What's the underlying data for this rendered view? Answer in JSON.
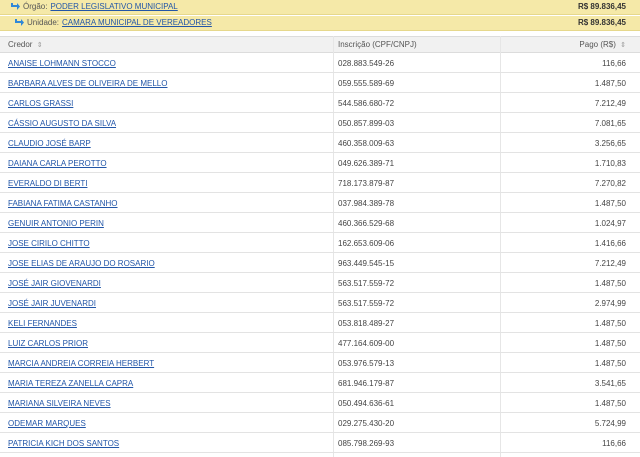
{
  "group": {
    "orgao": {
      "label": "Órgão:",
      "link": "PODER LEGISLATIVO MUNICIPAL",
      "value": "R$ 89.836,45"
    },
    "unidade": {
      "label": "Unidade:",
      "link": "CAMARA MUNICIPAL DE VEREADORES",
      "value": "R$ 89.836,45"
    }
  },
  "table": {
    "headers": {
      "credor": "Credor",
      "inscricao": "Inscrição (CPF/CNPJ)",
      "pago": "Pago (R$)",
      "sort_icon": "⇕"
    },
    "rows": [
      {
        "credor": "ANAISE LOHMANN STOCCO",
        "inscricao": "028.883.549-26",
        "pago": "116,66"
      },
      {
        "credor": "BARBARA ALVES DE OLIVEIRA DE MELLO",
        "inscricao": "059.555.589-69",
        "pago": "1.487,50"
      },
      {
        "credor": "CARLOS GRASSI",
        "inscricao": "544.586.680-72",
        "pago": "7.212,49"
      },
      {
        "credor": "CÁSSIO AUGUSTO DA SILVA",
        "inscricao": "050.857.899-03",
        "pago": "7.081,65"
      },
      {
        "credor": "CLAUDIO JOSÉ BARP",
        "inscricao": "460.358.009-63",
        "pago": "3.256,65"
      },
      {
        "credor": "DAIANA CARLA PEROTTO",
        "inscricao": "049.626.389-71",
        "pago": "1.710,83"
      },
      {
        "credor": "EVERALDO DI BERTI",
        "inscricao": "718.173.879-87",
        "pago": "7.270,82"
      },
      {
        "credor": "FABIANA FATIMA CASTANHO",
        "inscricao": "037.984.389-78",
        "pago": "1.487,50"
      },
      {
        "credor": "GENUIR ANTONIO PERIN",
        "inscricao": "460.366.529-68",
        "pago": "1.024,97"
      },
      {
        "credor": "JOSE CIRILO CHITTO",
        "inscricao": "162.653.609-06",
        "pago": "1.416,66"
      },
      {
        "credor": "JOSE ELIAS DE ARAUJO DO ROSARIO",
        "inscricao": "963.449.545-15",
        "pago": "7.212,49"
      },
      {
        "credor": "JOSÉ JAIR GIOVENARDI",
        "inscricao": "563.517.559-72",
        "pago": "1.487,50"
      },
      {
        "credor": "JOSÉ JAIR JUVENARDI",
        "inscricao": "563.517.559-72",
        "pago": "2.974,99"
      },
      {
        "credor": "KELI FERNANDES",
        "inscricao": "053.818.489-27",
        "pago": "1.487,50"
      },
      {
        "credor": "LUIZ CARLOS PRIOR",
        "inscricao": "477.164.609-00",
        "pago": "1.487,50"
      },
      {
        "credor": "MARCIA ANDREIA CORREIA HERBERT",
        "inscricao": "053.976.579-13",
        "pago": "1.487,50"
      },
      {
        "credor": "MARIA TEREZA ZANELLA CAPRA",
        "inscricao": "681.946.179-87",
        "pago": "3.541,65"
      },
      {
        "credor": "MARIANA SILVEIRA NEVES",
        "inscricao": "050.494.636-61",
        "pago": "1.487,50"
      },
      {
        "credor": "ODEMAR MARQUES",
        "inscricao": "029.275.430-20",
        "pago": "5.724,99"
      },
      {
        "credor": "PATRICIA KICH DOS SANTOS",
        "inscricao": "085.798.269-93",
        "pago": "116,66"
      }
    ]
  },
  "icons": {
    "group_arrow": "arrow-return-icon"
  },
  "colors": {
    "group_bg": "#f5e9a8",
    "link": "#2256a8",
    "arrow": "#2f88d8"
  }
}
